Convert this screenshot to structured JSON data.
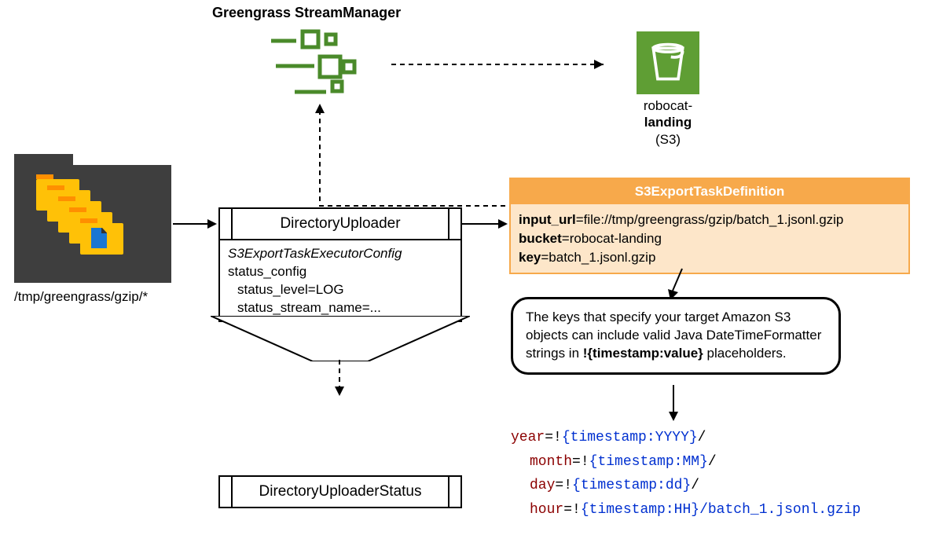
{
  "title": "Greengrass StreamManager",
  "folder": {
    "caption": "/tmp/greengrass/gzip/*"
  },
  "uploader": {
    "name": "DirectoryUploader",
    "config_title": "S3ExportTaskExecutorConfig",
    "line1": "status_config",
    "line2": "status_level=LOG",
    "line3": "status_stream_name=..."
  },
  "status_box": "DirectoryUploaderStatus",
  "s3def": {
    "header": "S3ExportTaskDefinition",
    "input_label": "input_url",
    "input_value": "=file://tmp/greengrass/gzip/batch_1.jsonl.gzip",
    "bucket_label": "bucket",
    "bucket_value": "=robocat-landing",
    "key_label": "key",
    "key_value": "=batch_1.jsonl.gzip"
  },
  "note": {
    "text_before": "The keys that specify your target Amazon S3 objects can include valid Java DateTimeFormatter",
    "text_after_prefix": "strings in ",
    "placeholder": "!{timestamp:value}",
    "text_after_suffix": " placeholders."
  },
  "code": {
    "year_kw": "year",
    "year_pl": "{timestamp:YYYY}",
    "month_kw": "month",
    "month_pl": "{timestamp:MM}",
    "day_kw": "day",
    "day_pl": "{timestamp:dd}",
    "hour_kw": "hour",
    "hour_pl": "{timestamp:HH}",
    "hour_tail": "/batch_1.jsonl.gzip",
    "eq": "=",
    "bang": "!",
    "slash": "/"
  },
  "s3": {
    "name_prefix": "robocat-",
    "name_bold": "landing",
    "sub": "(S3)"
  }
}
